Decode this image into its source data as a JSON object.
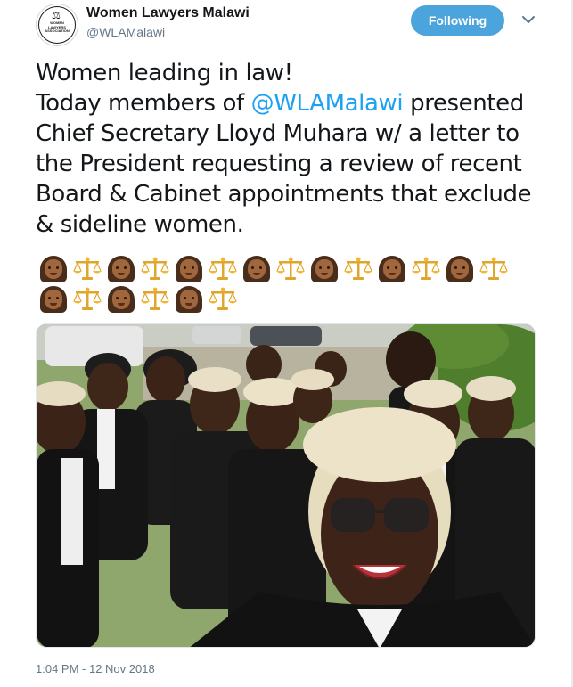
{
  "header": {
    "display_name": "Women Lawyers Malawi",
    "handle": "@WLAMalawi",
    "avatar_text": "WOMEN LAWYERS ASSOCIATION",
    "avatar_icon": "scales-of-justice-icon",
    "follow_label": "Following",
    "menu_icon": "chevron-down-icon",
    "accent_color": "#4ba4db"
  },
  "tweet": {
    "line1": "Women leading in law!",
    "line2_prefix": "Today members of ",
    "mention": "@WLAMalawi",
    "line2_suffix": " presented",
    "rest": "Chief Secretary Lloyd Muhara w/ a letter to the President requesting a review of recent Board & Cabinet appointments that exclude & sideline women.",
    "emoji_row1": [
      "woman",
      "scales",
      "woman",
      "scales",
      "woman",
      "scales",
      "woman",
      "scales",
      "woman",
      "scales",
      "woman",
      "scales",
      "woman",
      "scales"
    ],
    "emoji_row2": [
      "woman",
      "scales",
      "woman",
      "scales",
      "woman",
      "scales"
    ],
    "mention_color": "#1da1f2"
  },
  "photo": {
    "alt": "Group selfie of women lawyers in white barrister wigs and black robes"
  },
  "footer": {
    "timestamp": "1:04 PM - 12 Nov 2018"
  }
}
